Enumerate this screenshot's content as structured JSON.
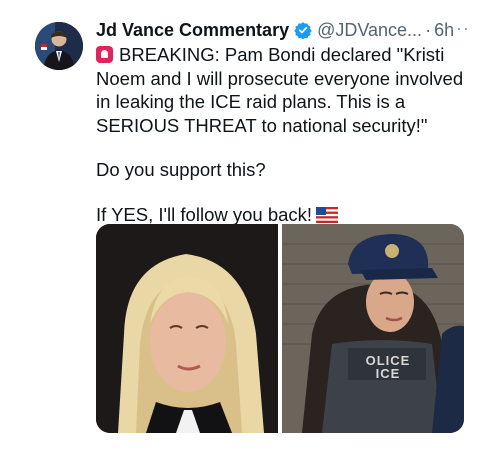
{
  "author": {
    "display_name": "Jd Vance Commentary",
    "handle": "@JDVance...",
    "separator": "·",
    "time": "6h",
    "verified_icon": "verified-badge-icon",
    "avatar_icon": "profile-avatar"
  },
  "more_menu": {
    "icon": "more-options-icon",
    "label": "···"
  },
  "text": {
    "paragraph1": "BREAKING: Pam Bondi declared \"Kristi Noem and I will prosecute everyone involved in leaking the ICE raid plans.  This is a SERIOUS THREAT to national security!\"",
    "paragraph2": "Do you support this?",
    "paragraph3": "If YES, I'll follow you back!"
  },
  "media": {
    "left_photo": "woman-with-blonde-hair-photo",
    "right_photo": "woman-in-cap-photo",
    "vest_line1": "OLICE",
    "vest_line2": "ICE"
  },
  "colors": {
    "accent": "#1d9bf0",
    "text": "#0f1419",
    "secondary": "#536471",
    "siren": "#e0245e"
  }
}
